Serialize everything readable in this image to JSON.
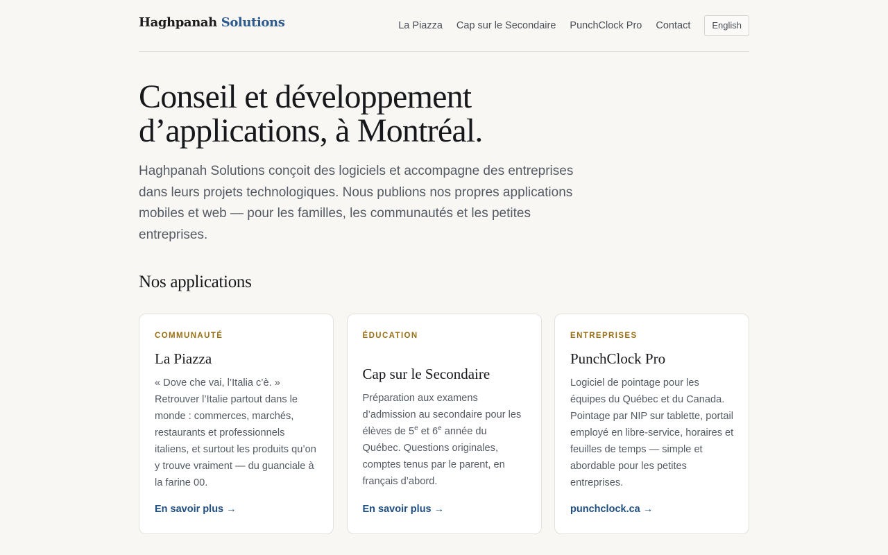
{
  "brand": {
    "name": "Haghpanah",
    "accent": "Solutions",
    "accent_color": "#2d5a8c"
  },
  "nav": {
    "items": [
      {
        "label": "La Piazza"
      },
      {
        "label": "Cap sur le Secondaire"
      },
      {
        "label": "PunchClock Pro"
      },
      {
        "label": "Contact"
      }
    ],
    "language_button": "English"
  },
  "hero": {
    "title_line1": "Conseil et développement",
    "title_line2": "d’applications, à Montréal.",
    "lead": "Haghpanah Solutions conçoit des logiciels et accompagne des entreprises dans leurs projets technologiques. Nous publions nos propres applications mobiles et web — pour les familles, les communautés et les petites entreprises."
  },
  "apps_section": {
    "title": "Nos applications",
    "cards": [
      {
        "tag": "COMMUNAUTÉ",
        "title": "La Piazza",
        "body": "« Dove che vai, l’Italia c’è. » Retrouver l’Italie partout dans le monde : commerces, marchés, restaurants et professionnels italiens, et surtout les produits qu’on y trouve vraiment — du guanciale à la farine 00.",
        "link": "En savoir plus",
        "arrow": "→"
      },
      {
        "tag": "ÉDUCATION",
        "title": "Cap sur le Secondaire",
        "body_pre": "Préparation aux examens d’admission au secondaire pour les élèves de 5",
        "sup1": "e",
        "body_mid": " et 6",
        "sup2": "e",
        "body_post": " année du Québec. Questions originales, comptes tenus par le parent, en français d’abord.",
        "link": "En savoir plus",
        "arrow": "→"
      },
      {
        "tag": "ENTREPRISES",
        "title": "PunchClock Pro",
        "body": "Logiciel de pointage pour les équipes du Québec et du Canada. Pointage par NIP sur tablette, portail employé en libre-service, horaires et feuilles de temps — simple et abordable pour les petites entreprises.",
        "link": "punchclock.ca",
        "arrow": "→"
      }
    ]
  },
  "colors": {
    "background": "#f8f7f4",
    "tag": "#9a6f14",
    "link": "#1f4e80"
  }
}
